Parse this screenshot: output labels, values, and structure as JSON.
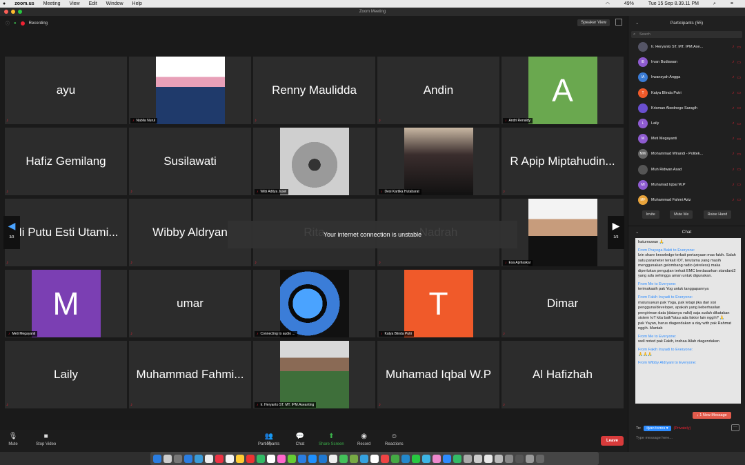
{
  "menubar": {
    "app": "zoom.us",
    "items": [
      "Meeting",
      "View",
      "Edit",
      "Window",
      "Help"
    ],
    "battery": "49%",
    "clock": "Tue 15 Sep  8.39.11 PM"
  },
  "window": {
    "title": "Zoom Meeting"
  },
  "meeting": {
    "recording_label": "Recording",
    "speaker_view": "Speaker View",
    "page_indicator": "3/3",
    "toast": "Your internet connection is unstable",
    "tiles": [
      {
        "name": "ayu"
      },
      {
        "name": "Nabila Nurul",
        "photo": "woman-hijab"
      },
      {
        "name": "Renny Maulidda"
      },
      {
        "name": "Andin"
      },
      {
        "name": "Andri Renaldy",
        "avatar_letter": "A",
        "avatar_color": "#6aa84f"
      },
      {
        "name": "Hafiz Gemilang"
      },
      {
        "name": "Susilawati"
      },
      {
        "name": "Wibi Aditya Jusel",
        "photo": "koala"
      },
      {
        "name": "Desi Kartika Hutabarat",
        "photo": "woman"
      },
      {
        "name": "R Apip Miptahudin..."
      },
      {
        "name": "Ni Putu Esti Utami..."
      },
      {
        "name": "Wibby Aldryan"
      },
      {
        "name": "Rita"
      },
      {
        "name": "Nadrah"
      },
      {
        "name": "Esa Aprilaskar",
        "photo": "man-suit"
      },
      {
        "name": "Meti Megayanti",
        "avatar_letter": "M",
        "avatar_color": "#7b3fb3"
      },
      {
        "name": "umar"
      },
      {
        "name": "Connecting to audio ...",
        "photo": "logo"
      },
      {
        "name": "Katya Blinda Putri",
        "avatar_letter": "T",
        "avatar_color": "#f05a2a"
      },
      {
        "name": "Dimar"
      },
      {
        "name": "Laily"
      },
      {
        "name": "Muhammad Fahmi..."
      },
      {
        "name": "Ir. Heryanto ST. MT. IPM.Aseanting",
        "photo": "man-vest"
      },
      {
        "name": "Muhamad Iqbal W.P"
      },
      {
        "name": "Al Hafizhah"
      }
    ]
  },
  "toolbar": {
    "mute": "Mute",
    "stop_video": "Stop Video",
    "participants": "Participants",
    "participants_count": "55",
    "chat": "Chat",
    "share_screen": "Share Screen",
    "record": "Record",
    "reactions": "Reactions",
    "leave": "Leave"
  },
  "participants_panel": {
    "title": "Participants (55)",
    "search_placeholder": "Search",
    "list": [
      {
        "name": "Ir. Heryanto ST. MT. IPM.Ase...",
        "initials": "",
        "color": "#556"
      },
      {
        "name": "Irvan Budiawan",
        "initials": "IB",
        "color": "#8e5bd0"
      },
      {
        "name": "Irwansyah Angga",
        "initials": "IA",
        "color": "#3a7bd5"
      },
      {
        "name": "Katya Blinda Putri",
        "initials": "T",
        "color": "#f05a2a"
      },
      {
        "name": "Krisman Abednego Saragih",
        "initials": "",
        "color": "#6a4fd0"
      },
      {
        "name": "Laily",
        "initials": "L",
        "color": "#8e5bd0"
      },
      {
        "name": "Meti Megayanti",
        "initials": "M",
        "color": "#8e5bd0"
      },
      {
        "name": "Mohammad Wirandi - Politek...",
        "initials": "MW",
        "color": "#666"
      },
      {
        "name": "Muh Ridwan Asad",
        "initials": "",
        "color": "#555"
      },
      {
        "name": "Muhamad Iqbal W.P",
        "initials": "MI",
        "color": "#8e5bd0"
      },
      {
        "name": "Muhammad Fahmi Aziz",
        "initials": "MF",
        "color": "#e8a33b"
      }
    ],
    "invite": "Invite",
    "mute_me": "Mute Me",
    "raise_hand": "Raise Hand"
  },
  "chat_panel": {
    "title": "Chat",
    "messages": [
      {
        "from": "",
        "text": "haturnuwun 🙏"
      },
      {
        "from": "From Prayoga Bakti to Everyone:",
        "text": "Izin share knowledge terkait pertanyaan mas fakih. Salah satu parameter terkait IOT, terutama yang masih menggunakan gelombang radio (wireless) maka diperlukan pengujian terkait EMC berdasarkan standard2 yang ada sehingga aman untuk digunakan."
      },
      {
        "from": "From Me to Everyone:",
        "text": "terimakasih pak Yog untuk tanggapannya"
      },
      {
        "from": "From Fakih Irsyadi to Everyone:",
        "text": "matursuwun pak Yoga, pak tetapi jika dari sisi pengguna/developer, apakah yang keberhasilan pengiriman data (datanya valid) saja sudah dikatakan sistem IoT kita baik?atau ada faktor lain nggih? 🙏"
      },
      {
        "from": "",
        "text": "pak Yayan, harus diagendakan a day with pak Rahmat nggih. Mantab"
      },
      {
        "from": "From Me to Everyone:",
        "text": "well noted pak Fakih, inshaa Allah diagendakan"
      },
      {
        "from": "From Fakih Irsyadi to Everyone:",
        "text": "🙏🙏🙏"
      },
      {
        "from": "From Wibby Aldryani to Everyone:",
        "text": ""
      }
    ],
    "new_message": "↓ 1 New Message",
    "to_label": "To:",
    "to_value": "ilyan torres ▾",
    "privately": "(Privately)",
    "input_placeholder": "Type message here..."
  }
}
